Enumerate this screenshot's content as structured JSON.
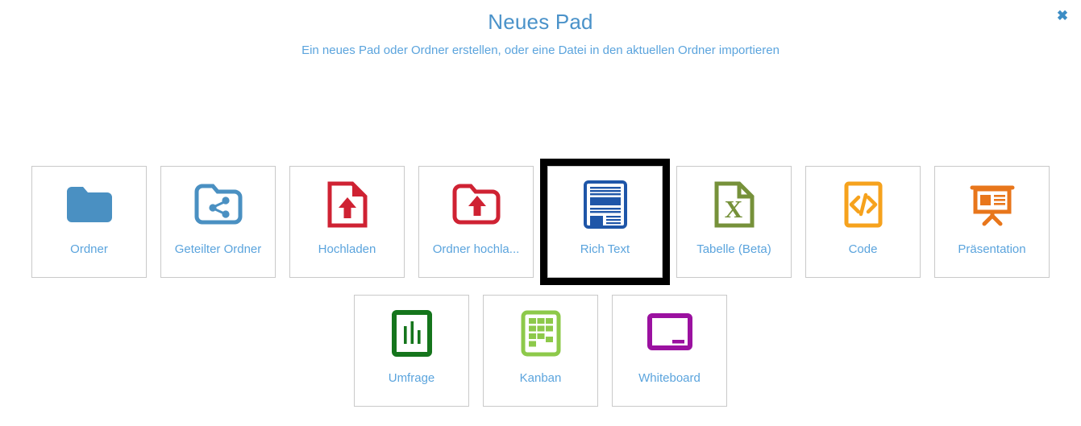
{
  "dialog": {
    "title": "Neues Pad",
    "subtitle": "Ein neues Pad oder Ordner erstellen, oder eine Datei in den aktuellen Ordner importieren",
    "close_label": "✖",
    "close_icon": "close-icon"
  },
  "colors": {
    "title": "#4a92c9",
    "label": "#5ba4dd",
    "tile_border": "#c9c9c9",
    "selection_outline": "#000000",
    "folder_blue": "#4a90c2",
    "shared_folder_blue": "#4a90c2",
    "upload_red": "#cf2233",
    "richtext_blue": "#1f56a8",
    "table_green": "#76913a",
    "code_orange": "#f6a21d",
    "presentation_orange": "#e8761b",
    "poll_green": "#15751c",
    "kanban_green": "#8dc94a",
    "whiteboard_purple": "#9b11a0"
  },
  "rows": [
    {
      "tiles": [
        {
          "id": "ordner",
          "label": "Ordner",
          "icon": "folder-icon",
          "selected": false
        },
        {
          "id": "geteilter-ordner",
          "label": "Geteilter Ordner",
          "icon": "shared-folder-icon",
          "selected": false
        },
        {
          "id": "hochladen",
          "label": "Hochladen",
          "icon": "upload-file-icon",
          "selected": false
        },
        {
          "id": "ordner-hochladen",
          "label": "Ordner hochla...",
          "icon": "upload-folder-icon",
          "selected": false
        },
        {
          "id": "rich-text",
          "label": "Rich Text",
          "icon": "rich-text-icon",
          "selected": true
        },
        {
          "id": "tabelle-beta",
          "label": "Tabelle (Beta)",
          "icon": "spreadsheet-icon",
          "selected": false
        },
        {
          "id": "code",
          "label": "Code",
          "icon": "code-icon",
          "selected": false
        },
        {
          "id": "praesentation",
          "label": "Präsentation",
          "icon": "presentation-icon",
          "selected": false
        }
      ]
    },
    {
      "tiles": [
        {
          "id": "umfrage",
          "label": "Umfrage",
          "icon": "poll-icon",
          "selected": false
        },
        {
          "id": "kanban",
          "label": "Kanban",
          "icon": "kanban-icon",
          "selected": false
        },
        {
          "id": "whiteboard",
          "label": "Whiteboard",
          "icon": "whiteboard-icon",
          "selected": false
        }
      ]
    }
  ]
}
